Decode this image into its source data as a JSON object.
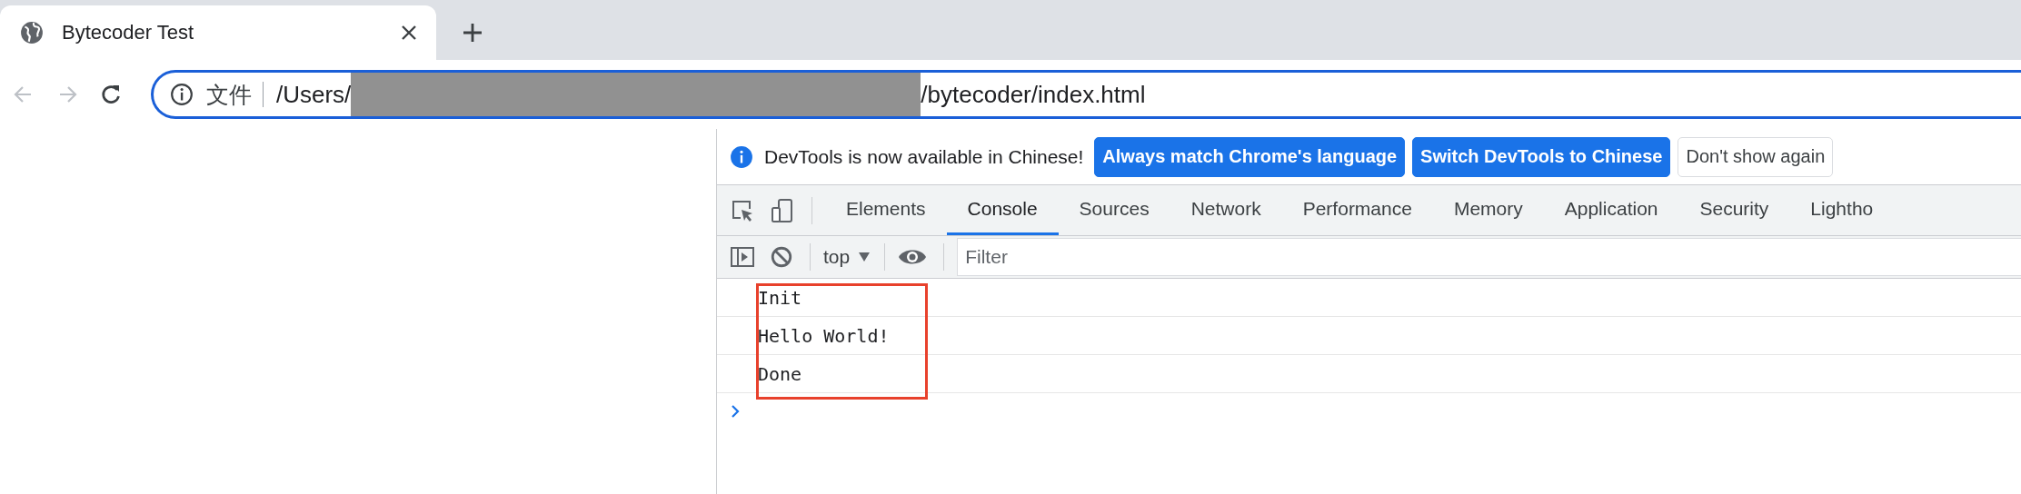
{
  "browser_tab": {
    "title": "Bytecoder Test",
    "selected": true
  },
  "nav_buttons": [
    {
      "kind": "back",
      "disabled": true
    },
    {
      "kind": "forward",
      "disabled": true
    },
    {
      "kind": "reload",
      "disabled": false
    }
  ],
  "address_bar": {
    "security_label": "文件",
    "url_start": "/Users/",
    "redacted": true,
    "url_end": "/bytecoder/index.html"
  },
  "infobar": {
    "message": "DevTools is now available in Chinese!",
    "buttons": [
      {
        "label": "Always match Chrome's language",
        "kind": "primary"
      },
      {
        "label": "Switch DevTools to Chinese",
        "kind": "primary"
      },
      {
        "label": "Don't show again",
        "kind": "secondary"
      }
    ]
  },
  "devtools_tabs": [
    {
      "label": "Elements",
      "selected": false
    },
    {
      "label": "Console",
      "selected": true
    },
    {
      "label": "Sources",
      "selected": false
    },
    {
      "label": "Network",
      "selected": false
    },
    {
      "label": "Performance",
      "selected": false
    },
    {
      "label": "Memory",
      "selected": false
    },
    {
      "label": "Application",
      "selected": false
    },
    {
      "label": "Security",
      "selected": false
    },
    {
      "label": "Lightho",
      "selected": false
    }
  ],
  "console_toolbar": {
    "context": "top",
    "filter_placeholder": "Filter"
  },
  "console": {
    "messages": [
      "Init",
      "Hello World!",
      "Done"
    ],
    "highlighted": true
  }
}
